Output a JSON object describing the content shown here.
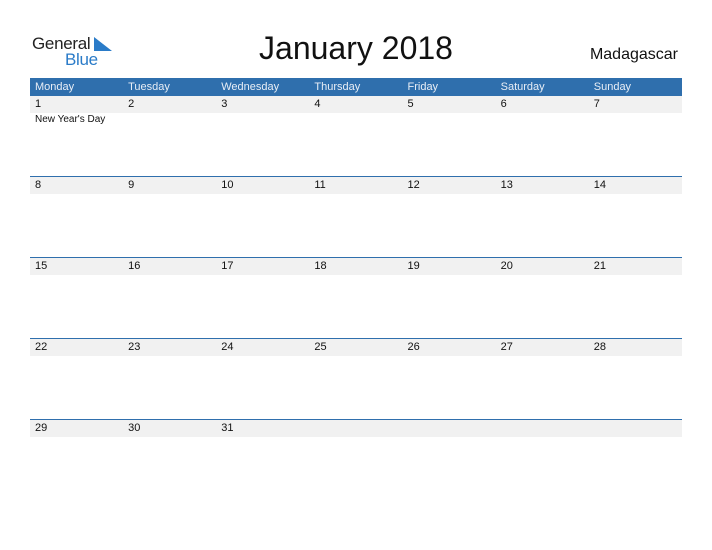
{
  "logo": {
    "part1": "General",
    "part2": "Blue",
    "accent_color": "#2a7bc8"
  },
  "title": "January 2018",
  "country": "Madagascar",
  "header_color": "#2f6fad",
  "weekdays": [
    "Monday",
    "Tuesday",
    "Wednesday",
    "Thursday",
    "Friday",
    "Saturday",
    "Sunday"
  ],
  "weeks": [
    {
      "days": [
        "1",
        "2",
        "3",
        "4",
        "5",
        "6",
        "7"
      ],
      "events": [
        "New Year's Day",
        "",
        "",
        "",
        "",
        "",
        ""
      ]
    },
    {
      "days": [
        "8",
        "9",
        "10",
        "11",
        "12",
        "13",
        "14"
      ],
      "events": [
        "",
        "",
        "",
        "",
        "",
        "",
        ""
      ]
    },
    {
      "days": [
        "15",
        "16",
        "17",
        "18",
        "19",
        "20",
        "21"
      ],
      "events": [
        "",
        "",
        "",
        "",
        "",
        "",
        ""
      ]
    },
    {
      "days": [
        "22",
        "23",
        "24",
        "25",
        "26",
        "27",
        "28"
      ],
      "events": [
        "",
        "",
        "",
        "",
        "",
        "",
        ""
      ]
    },
    {
      "days": [
        "29",
        "30",
        "31",
        "",
        "",
        "",
        ""
      ],
      "events": [
        "",
        "",
        "",
        "",
        "",
        "",
        ""
      ]
    }
  ]
}
